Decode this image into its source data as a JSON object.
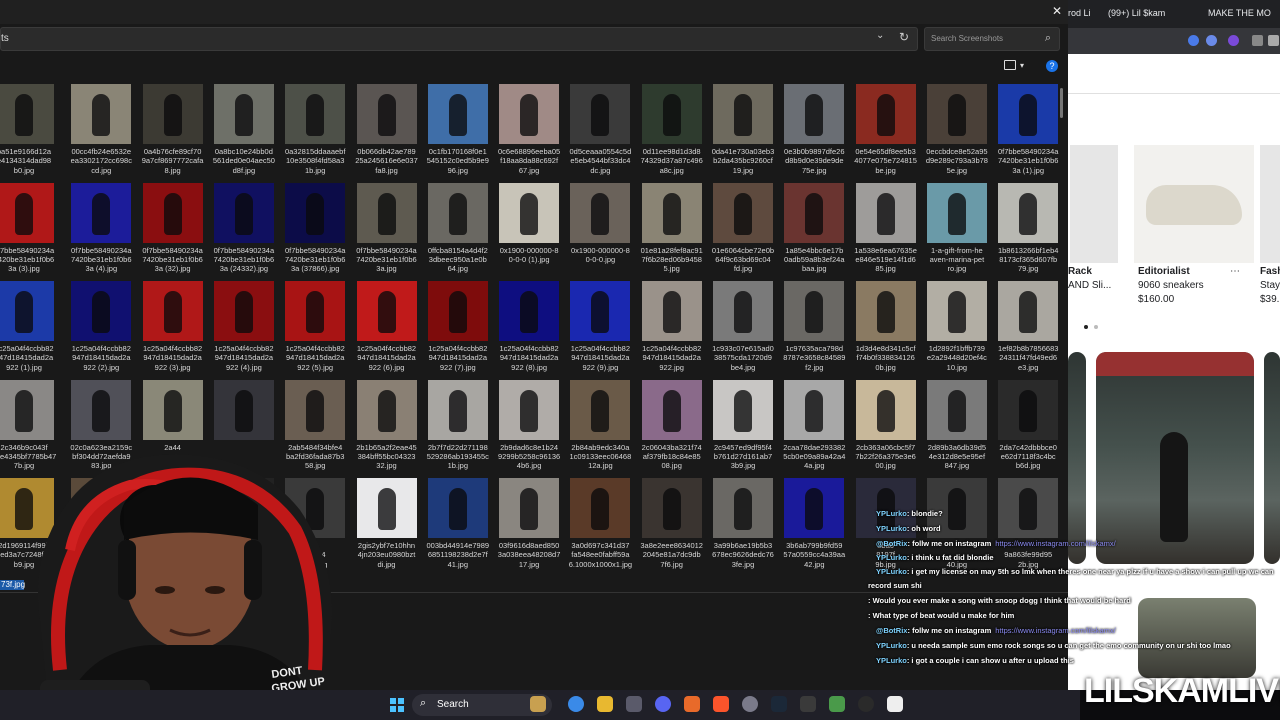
{
  "browser": {
    "tabs": [
      {
        "label": "rod Li"
      },
      {
        "label": "(99+) Lil $kam"
      },
      {
        "label": "MAKE THE MO"
      }
    ],
    "products": [
      {
        "store": "Rack",
        "name": "AND Sli..."
      },
      {
        "store": "Editorialist",
        "name": "9060 sneakers",
        "price": "$160.00"
      },
      {
        "store": "Fash",
        "name": "Stay",
        "price": "$39."
      }
    ]
  },
  "explorer": {
    "path": "ts",
    "search_placeholder": "Search Screenshots",
    "status_selected": "73f.jpg",
    "files": [
      {
        "name": "ba51e9166d12a\ne4134314dad98\nb0.jpg",
        "color": "#4a4a40"
      },
      {
        "name": "00cc4fb24e6532e\nea3302172cc698c\ncd.jpg",
        "color": "#8a8576"
      },
      {
        "name": "0a4b76cfe89cf70\n9a7cf8697772cafa\n8.jpg",
        "color": "#3c3a33"
      },
      {
        "name": "0a8bc10e24bb0d\n561ded0e04aec50\nd8f.jpg",
        "color": "#6e7068"
      },
      {
        "name": "0a32815ddaaaebf\n10e3508f4fd58a3\n1b.jpg",
        "color": "#4d5048"
      },
      {
        "name": "0b066db42ae789\n25a245616e6e037\nfa8.jpg",
        "color": "#5a5552"
      },
      {
        "name": "0c1fb170168f0e1\n545152c0ed5b9e9\n96.jpg",
        "color": "#3f6ea8"
      },
      {
        "name": "0c6e68896eeba05\nf18aa8da88c692f\n67.jpg",
        "color": "#a08a86"
      },
      {
        "name": "0d5ceaaa0554c5d\ne5eb4544bf33dc4\ndc.jpg",
        "color": "#3a3a3a"
      },
      {
        "name": "0d11ee98d1d3d8\n74329d37a87c496\na8c.jpg",
        "color": "#2e3b2e"
      },
      {
        "name": "0da41e730a03eb3\nb2da435bc9260cf\n19.jpg",
        "color": "#6e6a5e"
      },
      {
        "name": "0e3b0b9897dfe26\nd8b9d0e39de9de\n75e.jpg",
        "color": "#6a6e74"
      },
      {
        "name": "0e54e65df8ee5b3\n4077e075e724815\nbe.jpg",
        "color": "#8a2a20"
      },
      {
        "name": "0eccbdce8e52a95\nd9e289c793a3b78\n5e.jpg",
        "color": "#4a4038"
      },
      {
        "name": "0f7bbe58490234a\n7420be31eb1f0b6\n3a (1).jpg",
        "color": "#1a3aa8"
      },
      {
        "name": "0f7bbe58490234a\n7420be31eb1f0b6\n3a (3).jpg",
        "color": "#b01818"
      },
      {
        "name": "0f7bbe58490234a\n7420be31eb1f0b6\n3a (4).jpg",
        "color": "#1c1c9a"
      },
      {
        "name": "0f7bbe58490234a\n7420be31eb1f0b6\n3a (32).jpg",
        "color": "#8a0e10"
      },
      {
        "name": "0f7bbe58490234a\n7420be31eb1f0b6\n3a (24332).jpg",
        "color": "#101060"
      },
      {
        "name": "0f7bbe58490234a\n7420be31eb1f0b6\n3a (37866).jpg",
        "color": "#0c0c48"
      },
      {
        "name": "0f7bbe58490234a\n7420be31eb1f0b6\n3a.jpg",
        "color": "#5e5a50"
      },
      {
        "name": "0ffcba8154a4d4f2\n3dbeec950a1e0b\n64.jpg",
        "color": "#6a6862"
      },
      {
        "name": "0x1900-000000-8\n0-0-0 (1).jpg",
        "color": "#c8c4b8"
      },
      {
        "name": "0x1900-000000-8\n0-0-0.jpg",
        "color": "#6a625a"
      },
      {
        "name": "01e81a28fef8ac91\n7f6b28ed06b9458\n5.jpg",
        "color": "#8a8474"
      },
      {
        "name": "01e6064cbe72e0b\n64f9c63bd69c04\nfd.jpg",
        "color": "#5e4a3e"
      },
      {
        "name": "1a85e4bbc6e17b\n0adb59a8b3ef24a\nbaa.jpg",
        "color": "#6a3430"
      },
      {
        "name": "1a538e6ea67635e\ne846e519e14f1d6\n85.jpg",
        "color": "#9e9c9a"
      },
      {
        "name": "1-a-gift-from-he\naven-marina-pet\nro.jpg",
        "color": "#6a9aa8"
      },
      {
        "name": "1b8613266bf1eb4\n8173cf365d607fb\n79.jpg",
        "color": "#b8b8b2"
      },
      {
        "name": "1c25a04f4ccbb82\n947d18415dad2a\n922 (1).jpg",
        "color": "#1c3aa8"
      },
      {
        "name": "1c25a04f4ccbb82\n947d18415dad2a\n922 (2).jpg",
        "color": "#101070"
      },
      {
        "name": "1c25a04f4ccbb82\n947d18415dad2a\n922 (3).jpg",
        "color": "#b01818"
      },
      {
        "name": "1c25a04f4ccbb82\n947d18415dad2a\n922 (4).jpg",
        "color": "#8a0e10"
      },
      {
        "name": "1c25a04f4ccbb82\n947d18415dad2a\n922 (5).jpg",
        "color": "#a81414"
      },
      {
        "name": "1c25a04f4ccbb82\n947d18415dad2a\n922 (6).jpg",
        "color": "#c01a1a"
      },
      {
        "name": "1c25a04f4ccbb82\n947d18415dad2a\n922 (7).jpg",
        "color": "#7e0c0c"
      },
      {
        "name": "1c25a04f4ccbb82\n947d18415dad2a\n922 (8).jpg",
        "color": "#0e0e80"
      },
      {
        "name": "1c25a04f4ccbb82\n947d18415dad2a\n922 (9).jpg",
        "color": "#1a28b0"
      },
      {
        "name": "1c25a04f4ccbb82\n947d18415dad2a\n922.jpg",
        "color": "#9a928a"
      },
      {
        "name": "1c933c07e615ad0\n38575cda1720d9\nbe4.jpg",
        "color": "#7a7a7a"
      },
      {
        "name": "1c97635aca798d\n8787e3658c84589\nf2.jpg",
        "color": "#6a6864"
      },
      {
        "name": "1d3d4e8d341c5cf\nf74b0f338834126\n0b.jpg",
        "color": "#8a7a62"
      },
      {
        "name": "1d2892f1bffb739\ne2a29448d20ef4c\n10.jpg",
        "color": "#b2aea4"
      },
      {
        "name": "1ef82b8b7856683\n24311f47fd49ed6\ne3.jpg",
        "color": "#aaa7a0"
      },
      {
        "name": "2c346b9c043f\nebe4345bf7785b47\n7b.jpg",
        "color": "#8a8886"
      },
      {
        "name": "02c0a623ea2159c\nbf304dd72aefda9\n83.jpg",
        "color": "#505058"
      },
      {
        "name": "2a44\n\n",
        "color": "#8a8878"
      },
      {
        "name": "\n\n",
        "color": "#34343a"
      },
      {
        "name": "2ab5484f34bfe4\nba2fd36fada87b3\n58.jpg",
        "color": "#6a5e52"
      },
      {
        "name": "2b1b65a2f2eae45\n384bff55bc04323\n32.jpg",
        "color": "#8a8074"
      },
      {
        "name": "2b7f7d22d271198\n529286ab193455c\n1b.jpg",
        "color": "#a8a6a2"
      },
      {
        "name": "2b9dad6c8e1b24\n9299b5258c96136\n4b6.jpg",
        "color": "#b0aca8"
      },
      {
        "name": "2b84ab9edc340a\n1c09133eec06468\n12a.jpg",
        "color": "#6a5a48"
      },
      {
        "name": "2c06043ba321f74\naf379fb18c84e85\n08.jpg",
        "color": "#8a6a8a"
      },
      {
        "name": "2c9457ed9df95f4\nb761d27d161ab7\n3b9.jpg",
        "color": "#c8c6c4"
      },
      {
        "name": "2caa78dae293382\n5cb0e09a89a42a4\n4a.jpg",
        "color": "#a8a8a8"
      },
      {
        "name": "2cb363a06cbc5f7\n7b22f26a375e3e6\n00.jpg",
        "color": "#c8b89a"
      },
      {
        "name": "2d89b3a6db39d5\n4e312d8e5e95ef\n847.jpg",
        "color": "#7a7a7a"
      },
      {
        "name": "2da7c42dbbbce0\ne62d7118f3c4bc\nb6d.jpg",
        "color": "#2a2a2a"
      },
      {
        "name": "2d1969114f99b\n4ed3a7c7248f19\nb9.jpg",
        "color": "#b08a30"
      },
      {
        "name": "2ec\n\n",
        "color": "#5a4a3a"
      },
      {
        "name": "\n\n",
        "color": "#222"
      },
      {
        "name": "\n\n",
        "color": "#222"
      },
      {
        "name": "\n54b24\nd98.jpg",
        "color": "#3a3a3a"
      },
      {
        "name": "2gis2ybf7e10hhn\n4jn203eu0980bzt\ndi.jpg",
        "color": "#e8e8ea"
      },
      {
        "name": "003bd44914e7989\n6851198238d2e7f\n41.jpg",
        "color": "#1e3a7a"
      },
      {
        "name": "03f9616d8aed850\n3a038eea48208d7\n17.jpg",
        "color": "#8a8680"
      },
      {
        "name": "3a0d697c341d37\nfa548ee0fabff59a\n6.1000x1000x1.jpg",
        "color": "#5a3a28"
      },
      {
        "name": "3a8e2eee8634012\n2045e81a7dc9db\n7f6.jpg",
        "color": "#3a3430"
      },
      {
        "name": "3a99b6ae19b5b3\n678ec9626dedc76\n3fe.jpg",
        "color": "#6a6864"
      },
      {
        "name": "3b6ab799b9fd59\n57a0559cc4a39aa\n42.jpg",
        "color": "#1a1a9a"
      },
      {
        "name": "3ba6\n8197f\n9b.jpg",
        "color": "#2a2a3a"
      },
      {
        "name": "\n\n40.jpg",
        "color": "#3a3a3a"
      },
      {
        "name": "\n9a863fe99d95\n2b.jpg",
        "color": "#4a4a4a"
      }
    ]
  },
  "chat": [
    {
      "user": "YPLurko",
      "msg": ": blondie?",
      "style": "u"
    },
    {
      "user": "YPLurko",
      "msg": ": oh word",
      "style": "u"
    },
    {
      "user": "@BotRix",
      "msg": ": follw me on instagram",
      "style": "u",
      "link": "https://www.instagram.com/lilskamx/"
    },
    {
      "user": "YPLurko",
      "msg": ": i think u fat did blondie",
      "style": "u"
    },
    {
      "user": "YPLurko",
      "msg": ": i get my license on may 5th so lmk when theres one near ya plzz if u have a show i can pull up we can",
      "style": "u"
    },
    {
      "user": "",
      "msg": "record sum shi",
      "style": "m"
    },
    {
      "user": "",
      "msg": ": Would you ever make a song with snoop dogg I think that would be hard",
      "style": "u2"
    },
    {
      "user": "",
      "msg": ": What type of beat would u make for him",
      "style": "u2"
    },
    {
      "user": "@BotRix",
      "msg": ": follw me on instagram",
      "style": "u",
      "link": "https://www.instagram.com/lilskamx/"
    },
    {
      "user": "YPLurko",
      "msg": ": u needa sample sum emo rock songs so u can get the emo community on ur shi too lmao",
      "style": "u"
    },
    {
      "user": "YPLurko",
      "msg": ": i got a couple i can show u after u upload this",
      "style": "u"
    }
  ],
  "watermark": "LILSKAMLIVE",
  "taskbar": {
    "search_label": "Search"
  }
}
